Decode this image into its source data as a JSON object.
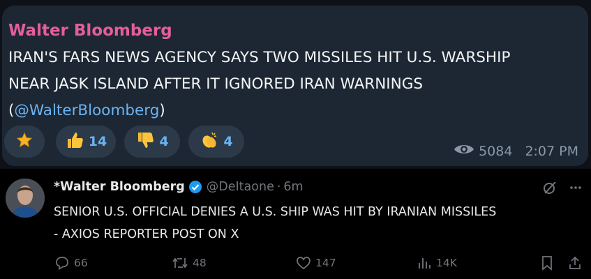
{
  "telegram": {
    "author": "Walter Bloomberg",
    "message_lines": [
      "IRAN'S FARS NEWS AGENCY SAYS TWO MISSILES HIT U.S. WARSHIP",
      "NEAR JASK ISLAND AFTER IT IGNORED IRAN WARNINGS"
    ],
    "link_text": "@WalterBloomberg",
    "reactions": [
      {
        "icon": "star-icon",
        "count": ""
      },
      {
        "icon": "thumbs-up-icon",
        "count": "14"
      },
      {
        "icon": "thumbs-down-icon",
        "count": "4"
      },
      {
        "icon": "clapping-hands-icon",
        "count": "4"
      }
    ],
    "views": "5084",
    "time": "2:07 PM",
    "colors": {
      "author": "#e35f9b",
      "link": "#6ab3f3",
      "bubble": "#1d2733"
    }
  },
  "tweet": {
    "display_name": "*Walter Bloomberg",
    "handle": "@DeItaone",
    "separator": "·",
    "time_ago": "6m",
    "body_lines": [
      "SENIOR U.S. OFFICIAL DENIES A U.S. SHIP WAS HIT BY IRANIAN MISSILES",
      "- AXIOS REPORTER POST ON X"
    ],
    "actions": {
      "replies": "66",
      "reposts": "48",
      "likes": "147",
      "views": "14K"
    },
    "colors": {
      "verified": "#1d9bf0",
      "muted": "#71767b"
    }
  }
}
